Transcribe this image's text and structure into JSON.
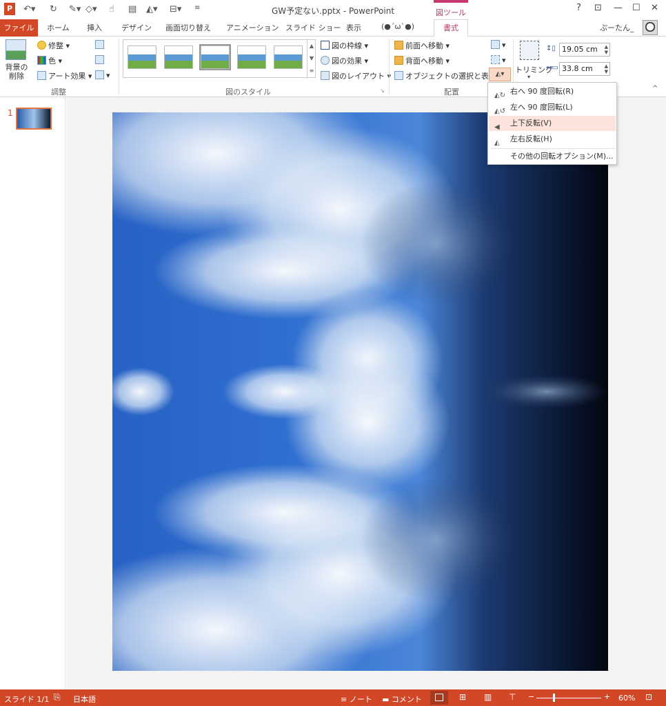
{
  "window": {
    "title": "GW予定ない.pptx - PowerPoint",
    "context_tool": "図ツール",
    "user": "ぷーたん_",
    "help": "?",
    "controls": {
      "restore_ribbon": "⊡",
      "minimize": "—",
      "maximize": "☐",
      "close": "✕"
    }
  },
  "tabs": {
    "file": "ファイル",
    "items": [
      "ホーム",
      "挿入",
      "デザイン",
      "画面切り替え",
      "アニメーション",
      "スライド ショー",
      "表示",
      "(●´ω`●)"
    ],
    "format": "書式"
  },
  "ribbon": {
    "adjust": {
      "remove_bg": "背景の削除",
      "corrections": "修整",
      "color": "色",
      "artistic": "アート効果",
      "label": "調整"
    },
    "styles": {
      "border": "図の枠線",
      "effects": "図の効果",
      "layout": "図のレイアウト",
      "label": "図のスタイル"
    },
    "arrange": {
      "forward": "前面へ移動",
      "backward": "背面へ移動",
      "selection": "オブジェクトの選択と表示",
      "label": "配置"
    },
    "size": {
      "crop": "トリミング",
      "height": "19.05 cm",
      "width": "33.8 cm"
    }
  },
  "rotate_menu": {
    "items": [
      {
        "label": "右へ 90 度回転(R)",
        "icon": "rotate-right-icon",
        "highlighted": false
      },
      {
        "label": "左へ 90 度回転(L)",
        "icon": "rotate-left-icon",
        "highlighted": false
      },
      {
        "label": "上下反転(V)",
        "icon": "flip-vertical-icon",
        "highlighted": true
      },
      {
        "label": "左右反転(H)",
        "icon": "flip-horizontal-icon",
        "highlighted": false
      }
    ],
    "more": "その他の回転オプション(M)..."
  },
  "slides_pane": {
    "number": "1"
  },
  "status": {
    "slide": "スライド 1/1",
    "language": "日本語",
    "notes": "ノート",
    "comments": "コメント",
    "zoom": "60%",
    "zoom_minus": "−",
    "zoom_plus": "+"
  },
  "colors": {
    "accent": "#d24726",
    "context": "#b83569",
    "highlight": "#fce4dc"
  }
}
